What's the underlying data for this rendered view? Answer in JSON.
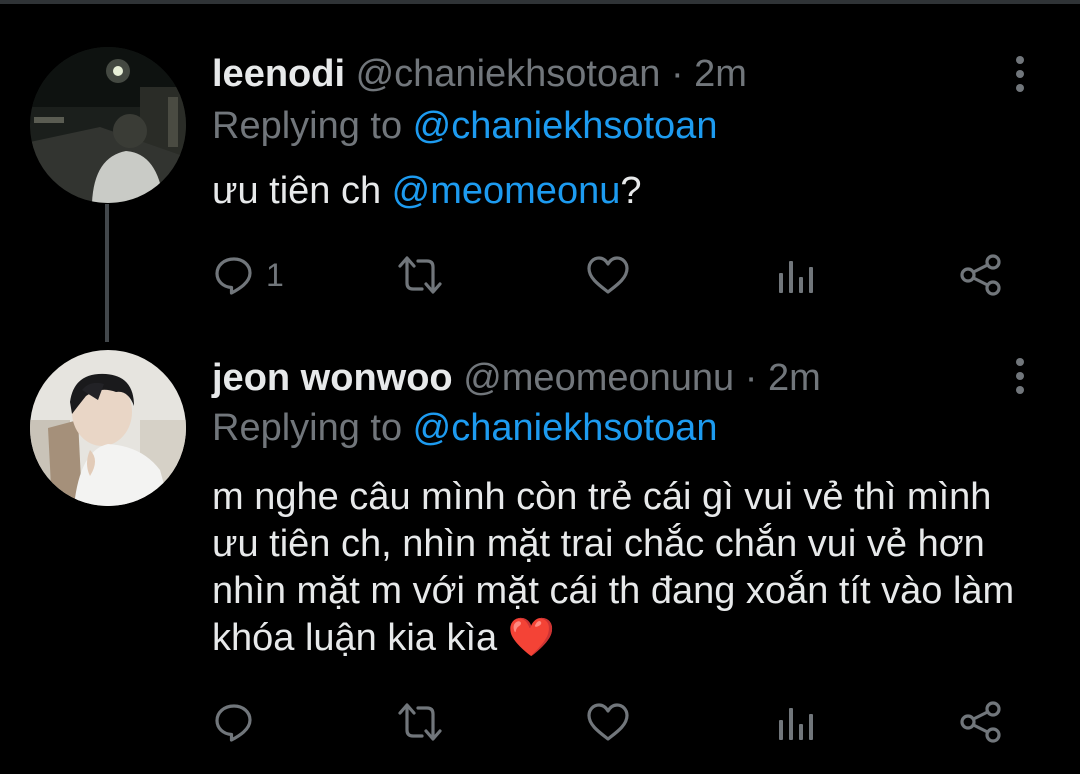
{
  "colors": {
    "background": "#000000",
    "text_primary": "#e7e9ea",
    "text_secondary": "#71767b",
    "link": "#1d9bf0",
    "thread_line": "#42474b",
    "heart": "#e0245e"
  },
  "tweets": [
    {
      "display_name": "leenodi",
      "handle": "@chaniekhsotoan",
      "separator": "·",
      "time": "2m",
      "replying_prefix": "Replying to ",
      "replying_to": "@chaniekhsotoan",
      "text_before": "ưu tiên ch ",
      "text_mention": "@meomeonu",
      "text_after": "?",
      "actions": {
        "reply_icon": "reply-icon",
        "reply_count": "1",
        "retweet_icon": "retweet-icon",
        "like_icon": "heart-icon",
        "stats_icon": "analytics-icon",
        "share_icon": "share-icon"
      }
    },
    {
      "display_name": "jeon wonwoo",
      "handle": "@meomeonunu",
      "separator": "·",
      "time": "2m",
      "replying_prefix": "Replying to ",
      "replying_to": "@chaniekhsotoan",
      "text": "m nghe câu mình còn trẻ cái gì vui vẻ thì mình ưu tiên ch, nhìn mặt trai chắc chắn vui vẻ hơn nhìn mặt m với mặt cái th đang xoắn tít vào làm khóa luận kia kìa",
      "emoji": "❤️",
      "actions": {
        "reply_icon": "reply-icon",
        "retweet_icon": "retweet-icon",
        "like_icon": "heart-icon",
        "stats_icon": "analytics-icon",
        "share_icon": "share-icon"
      }
    }
  ]
}
